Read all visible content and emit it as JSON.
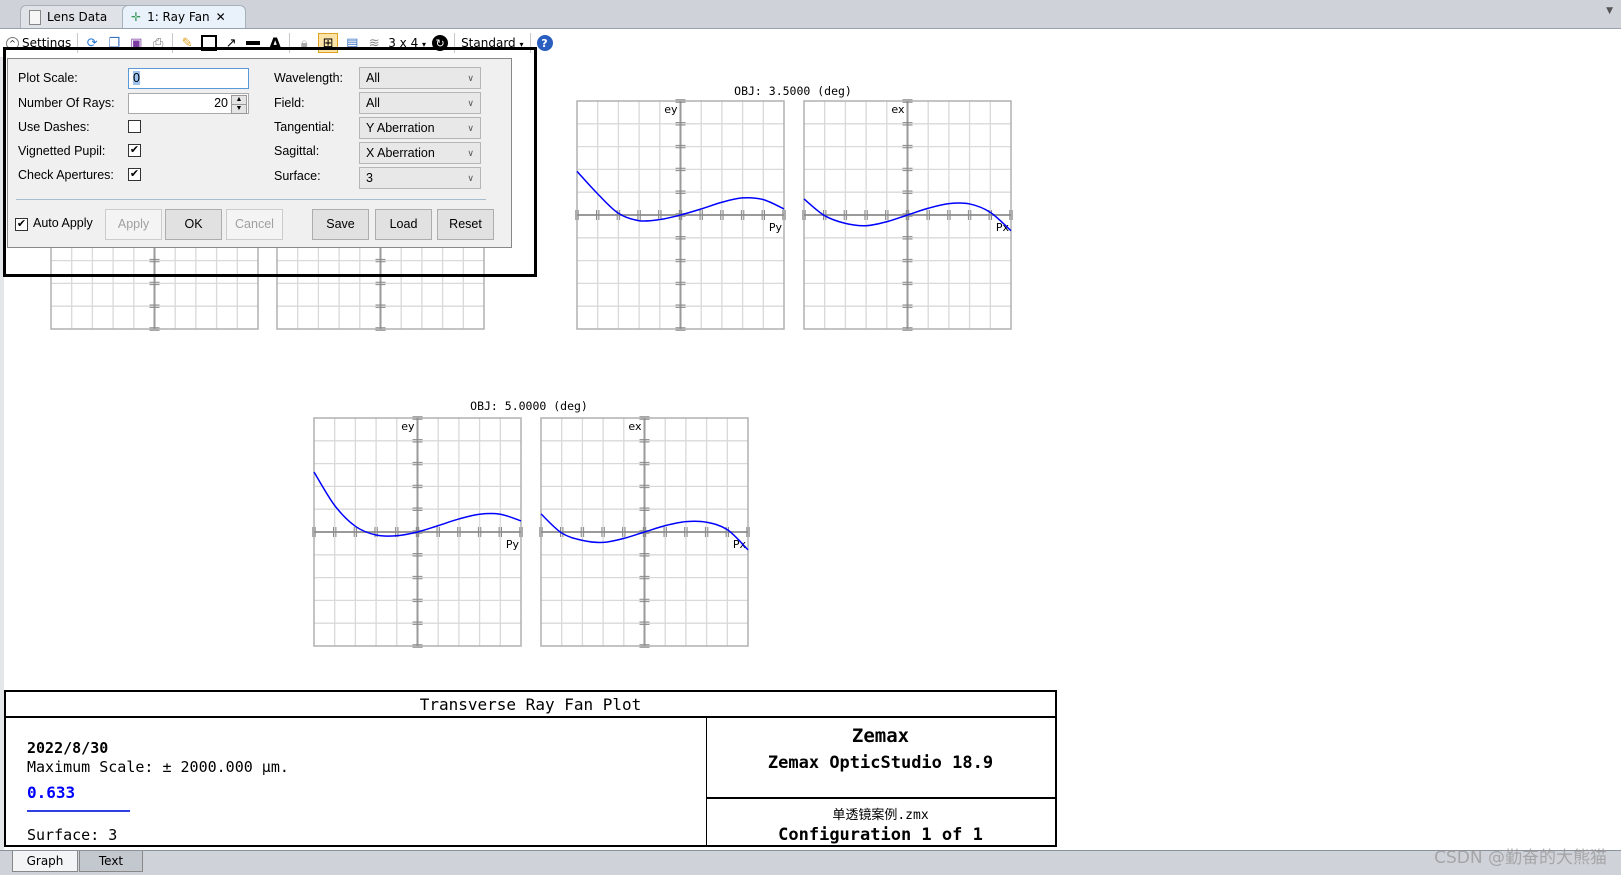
{
  "tabs": [
    {
      "label": "Lens Data",
      "icon": "document-icon",
      "active": false
    },
    {
      "label": "1: Ray Fan",
      "icon": "ray-fan-icon",
      "active": true,
      "closable": true
    }
  ],
  "toolbar": {
    "settings_label": "Settings",
    "layout_label": "3 x 4",
    "style_label": "Standard",
    "icons": [
      "refresh-icon",
      "copy-icon",
      "save-image-icon",
      "print-icon",
      "pencil-icon",
      "rectangle-icon",
      "arrow-icon",
      "line-icon",
      "text-icon",
      "lock-icon",
      "layout-grid-icon",
      "window-icon",
      "layers-icon",
      "rotate-icon",
      "help-icon"
    ]
  },
  "dialog": {
    "plot_scale": {
      "label": "Plot Scale:",
      "value": "0"
    },
    "number_of_rays": {
      "label": "Number Of Rays:",
      "value": "20"
    },
    "use_dashes": {
      "label": "Use Dashes:",
      "checked": false
    },
    "vignetted_pupil": {
      "label": "Vignetted Pupil:",
      "checked": true
    },
    "check_apertures": {
      "label": "Check Apertures:",
      "checked": true
    },
    "wavelength": {
      "label": "Wavelength:",
      "value": "All"
    },
    "field": {
      "label": "Field:",
      "value": "All"
    },
    "tangential": {
      "label": "Tangential:",
      "value": "Y Aberration"
    },
    "sagittal": {
      "label": "Sagittal:",
      "value": "X Aberration"
    },
    "surface": {
      "label": "Surface:",
      "value": "3"
    },
    "auto_apply": {
      "label": "Auto Apply",
      "checked": true
    },
    "buttons": {
      "apply": "Apply",
      "ok": "OK",
      "cancel": "Cancel",
      "save": "Save",
      "load": "Load",
      "reset": "Reset"
    }
  },
  "chart_data": [
    {
      "type": "line",
      "title": "OBJ: 3.5000 (deg)",
      "xlabel": "Py",
      "ylabel": "ey",
      "xlim": [
        -1,
        1
      ],
      "ylim": [
        -2000,
        2000
      ],
      "grid": true,
      "color": "#0000ff",
      "x": [
        -1,
        -0.8,
        -0.6,
        -0.4,
        -0.2,
        0,
        0.2,
        0.4,
        0.6,
        0.8,
        1
      ],
      "y": [
        765,
        370,
        30,
        -100,
        -80,
        0,
        106,
        224,
        300,
        270,
        106
      ]
    },
    {
      "type": "line",
      "title": "OBJ: 3.5000 (deg)",
      "xlabel": "Px",
      "ylabel": "ex",
      "xlim": [
        -1,
        1
      ],
      "ylim": [
        -2000,
        2000
      ],
      "grid": true,
      "color": "#0000ff",
      "x": [
        -1,
        -0.8,
        -0.6,
        -0.4,
        -0.2,
        0,
        0.2,
        0.4,
        0.6,
        0.8,
        1
      ],
      "y": [
        282,
        -12,
        -147,
        -188,
        -118,
        0,
        118,
        200,
        194,
        47,
        -276
      ]
    },
    {
      "type": "line",
      "title": "OBJ: 5.0000 (deg)",
      "xlabel": "Py",
      "ylabel": "ey",
      "xlim": [
        -1,
        1
      ],
      "ylim": [
        -2000,
        2000
      ],
      "grid": true,
      "color": "#0000ff",
      "x": [
        -1,
        -0.8,
        -0.6,
        -0.4,
        -0.2,
        0,
        0.2,
        0.4,
        0.6,
        0.8,
        1
      ],
      "y": [
        1053,
        465,
        100,
        -53,
        -65,
        0,
        112,
        229,
        312,
        312,
        194
      ]
    },
    {
      "type": "line",
      "title": "OBJ: 5.0000 (deg)",
      "xlabel": "Px",
      "ylabel": "ex",
      "xlim": [
        -1,
        1
      ],
      "ylim": [
        -2000,
        2000
      ],
      "grid": true,
      "color": "#0000ff",
      "x": [
        -1,
        -0.8,
        -0.6,
        -0.4,
        -0.2,
        0,
        0.2,
        0.4,
        0.6,
        0.8,
        1
      ],
      "y": [
        318,
        -18,
        -147,
        -182,
        -112,
        0,
        112,
        182,
        171,
        41,
        -312
      ]
    }
  ],
  "footer": {
    "title": "Transverse Ray Fan Plot",
    "date": "2022/8/30",
    "max_scale": "Maximum Scale: ± 2000.000 µm.",
    "wavelength": "0.633",
    "wavelength_color": "#0000ff",
    "surface": "Surface: 3",
    "company": "Zemax",
    "product": "Zemax OpticStudio 18.9",
    "file": "单透镜案例.zmx",
    "configuration": "Configuration 1 of 1"
  },
  "bottom_tabs": [
    {
      "label": "Graph",
      "active": true
    },
    {
      "label": "Text",
      "active": false
    }
  ],
  "watermark": "CSDN @勤奋的大熊猫"
}
